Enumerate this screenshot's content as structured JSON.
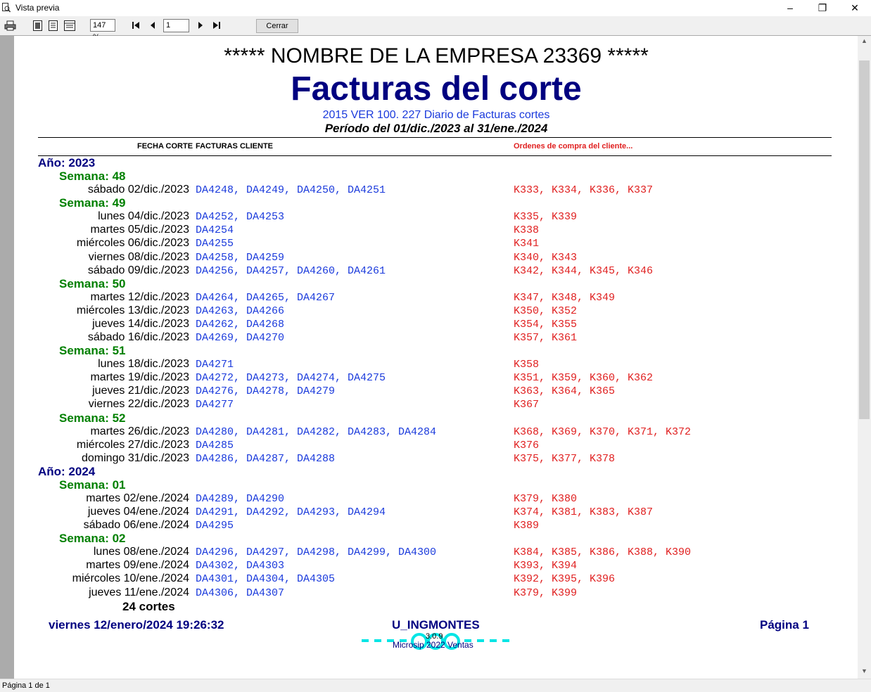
{
  "window": {
    "title": "Vista previa",
    "minimize": "–",
    "restore": "❐",
    "close": "✕"
  },
  "toolbar": {
    "zoom": "147 %",
    "page_input": "1",
    "close_label": "Cerrar",
    "icons": [
      "printer-icon",
      "single-page-icon",
      "two-page-icon",
      "multi-page-icon",
      "first-page-icon",
      "prev-page-icon",
      "next-page-icon",
      "last-page-icon"
    ]
  },
  "report": {
    "company": "***** NOMBRE DE LA EMPRESA 23369 *****",
    "title": "Facturas del corte",
    "subtitle": "2015 VER 100. 227 Diario de Facturas cortes",
    "period": "Período del 01/dic./2023 al 31/ene./2024",
    "col_fecha": "FECHA CORTE",
    "col_facturas": "FACTURAS CLIENTE",
    "col_ordenes": "Ordenes de compra del cliente...",
    "rows": [
      {
        "type": "year",
        "label": "Año: 2023"
      },
      {
        "type": "week",
        "label": "Semana: 48"
      },
      {
        "type": "day",
        "date": "sábado 02/dic./2023",
        "invoices": "DA4248, DA4249, DA4250, DA4251",
        "orders": "K333, K334, K336, K337"
      },
      {
        "type": "week",
        "label": "Semana: 49"
      },
      {
        "type": "day",
        "date": "lunes 04/dic./2023",
        "invoices": "DA4252, DA4253",
        "orders": "K335, K339"
      },
      {
        "type": "day",
        "date": "martes 05/dic./2023",
        "invoices": "DA4254",
        "orders": "K338"
      },
      {
        "type": "day",
        "date": "miércoles 06/dic./2023",
        "invoices": "DA4255",
        "orders": "K341"
      },
      {
        "type": "day",
        "date": "viernes 08/dic./2023",
        "invoices": "DA4258, DA4259",
        "orders": "K340, K343"
      },
      {
        "type": "day",
        "date": "sábado 09/dic./2023",
        "invoices": "DA4256, DA4257, DA4260, DA4261",
        "orders": "K342, K344, K345, K346"
      },
      {
        "type": "week",
        "label": "Semana: 50"
      },
      {
        "type": "day",
        "date": "martes 12/dic./2023",
        "invoices": "DA4264, DA4265, DA4267",
        "orders": "K347, K348, K349"
      },
      {
        "type": "day",
        "date": "miércoles 13/dic./2023",
        "invoices": "DA4263, DA4266",
        "orders": "K350, K352"
      },
      {
        "type": "day",
        "date": "jueves 14/dic./2023",
        "invoices": "DA4262, DA4268",
        "orders": "K354, K355"
      },
      {
        "type": "day",
        "date": "sábado 16/dic./2023",
        "invoices": "DA4269, DA4270",
        "orders": "K357, K361"
      },
      {
        "type": "week",
        "label": "Semana: 51"
      },
      {
        "type": "day",
        "date": "lunes 18/dic./2023",
        "invoices": "DA4271",
        "orders": "K358"
      },
      {
        "type": "day",
        "date": "martes 19/dic./2023",
        "invoices": "DA4272, DA4273, DA4274, DA4275",
        "orders": "K351, K359, K360, K362"
      },
      {
        "type": "day",
        "date": "jueves 21/dic./2023",
        "invoices": "DA4276, DA4278, DA4279",
        "orders": "K363, K364, K365"
      },
      {
        "type": "day",
        "date": "viernes 22/dic./2023",
        "invoices": "DA4277",
        "orders": "K367"
      },
      {
        "type": "week",
        "label": "Semana: 52"
      },
      {
        "type": "day",
        "date": "martes 26/dic./2023",
        "invoices": "DA4280, DA4281, DA4282, DA4283, DA4284",
        "orders": "K368, K369, K370, K371, K372"
      },
      {
        "type": "day",
        "date": "miércoles 27/dic./2023",
        "invoices": "DA4285",
        "orders": "K376"
      },
      {
        "type": "day",
        "date": "domingo 31/dic./2023",
        "invoices": "DA4286, DA4287, DA4288",
        "orders": "K375, K377, K378"
      },
      {
        "type": "year",
        "label": "Año: 2024"
      },
      {
        "type": "week",
        "label": "Semana: 01"
      },
      {
        "type": "day",
        "date": "martes 02/ene./2024",
        "invoices": "DA4289, DA4290",
        "orders": "K379, K380"
      },
      {
        "type": "day",
        "date": "jueves 04/ene./2024",
        "invoices": "DA4291, DA4292, DA4293, DA4294",
        "orders": "K374, K381, K383, K387"
      },
      {
        "type": "day",
        "date": "sábado 06/ene./2024",
        "invoices": "DA4295",
        "orders": "K389"
      },
      {
        "type": "week",
        "label": "Semana: 02"
      },
      {
        "type": "day",
        "date": "lunes 08/ene./2024",
        "invoices": "DA4296, DA4297, DA4298, DA4299, DA4300",
        "orders": "K384, K385, K386, K388, K390"
      },
      {
        "type": "day",
        "date": "martes 09/ene./2024",
        "invoices": "DA4302, DA4303",
        "orders": "K393, K394"
      },
      {
        "type": "day",
        "date": "miércoles 10/ene./2024",
        "invoices": "DA4301, DA4304, DA4305",
        "orders": "K392, K395, K396"
      },
      {
        "type": "day",
        "date": "jueves 11/ene./2024",
        "invoices": "DA4306, DA4307",
        "orders": "K379, K399"
      },
      {
        "type": "total",
        "label": "24 cortes"
      }
    ],
    "footer": {
      "datetime": "viernes 12/enero/2024 19:26:32",
      "user": "U_INGMONTES",
      "page": "Página 1",
      "version": "3.0.9",
      "product": "Microsip 2022 Ventas"
    }
  },
  "status": {
    "text": "Página 1 de 1"
  },
  "colors": {
    "navy": "#000080",
    "blue": "#1a3adc",
    "green": "#008000",
    "red": "#e02020",
    "cyan": "#00e5e5"
  }
}
